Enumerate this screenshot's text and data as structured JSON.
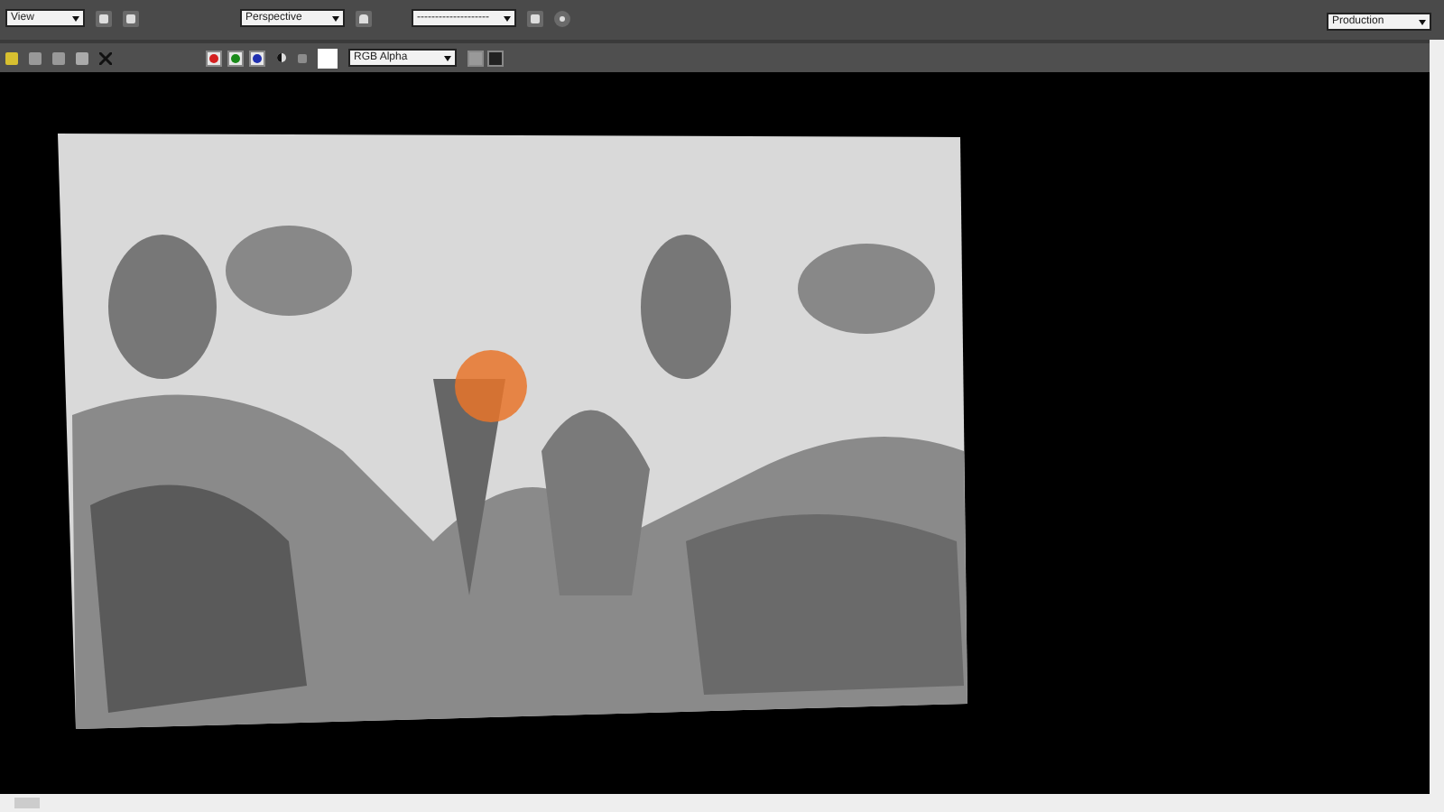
{
  "toolbar": {
    "groups": [
      {
        "value": "View"
      },
      {
        "value": "Perspective"
      },
      {
        "value": "--------------------"
      }
    ],
    "preset": {
      "value": "Production"
    }
  },
  "display_bar": {
    "channels": [
      {
        "color": "#d42020",
        "on": true
      },
      {
        "color": "#1a8a1a",
        "on": true
      },
      {
        "color": "#2030b0",
        "on": true
      }
    ],
    "channel_select": {
      "value": "RGB Alpha"
    }
  }
}
